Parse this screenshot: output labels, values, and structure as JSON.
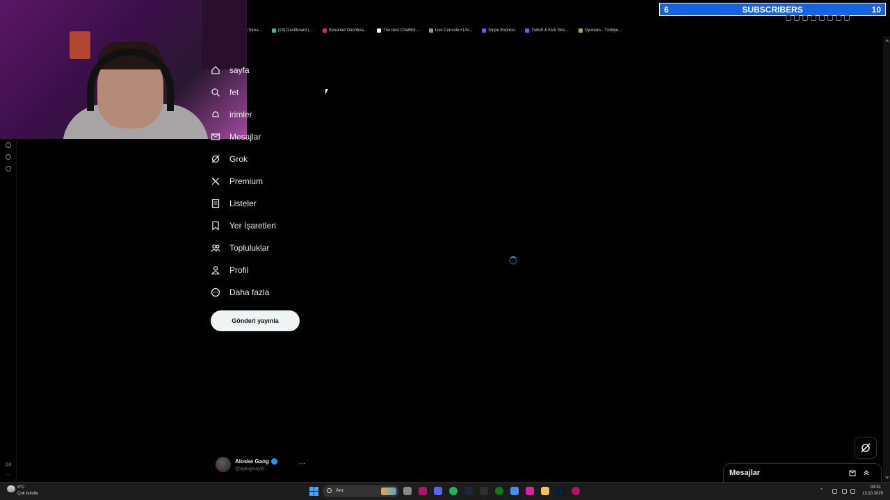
{
  "browser": {
    "bookmarks": [
      {
        "label": "ng Strea...",
        "color": "#9146ff"
      },
      {
        "label": "(23) Dashboard |...",
        "color": "#3fb9a6"
      },
      {
        "label": "Streamer Dashboa...",
        "color": "#e0245e"
      },
      {
        "label": "The best ChatBot...",
        "color": "#ffffff"
      },
      {
        "label": "Live Console • LIV...",
        "color": "#999999"
      },
      {
        "label": "Stripe Express",
        "color": "#635bff"
      },
      {
        "label": "Twitch & Kick Stre...",
        "color": "#9146ff"
      },
      {
        "label": "Oyuneks - Türkiye...",
        "color": "#7fbf3f"
      }
    ]
  },
  "overlay": {
    "sub_left": "6",
    "sub_label": "SUBSCRIBERS",
    "sub_right": "10",
    "bar_color": "#1463e6"
  },
  "nav": {
    "items": [
      {
        "label": "sayfa",
        "icon": "home-icon"
      },
      {
        "label": "fet",
        "icon": "search-icon"
      },
      {
        "label": "irimler",
        "icon": "bell-icon"
      },
      {
        "label": "Mesajlar",
        "icon": "mail-icon"
      },
      {
        "label": "Grok",
        "icon": "grok-icon"
      },
      {
        "label": "Premium",
        "icon": "x-logo-icon"
      },
      {
        "label": "Listeler",
        "icon": "list-icon"
      },
      {
        "label": "Yer İşaretleri",
        "icon": "bookmark-icon"
      },
      {
        "label": "Topluluklar",
        "icon": "communities-icon"
      },
      {
        "label": "Profil",
        "icon": "profile-icon"
      },
      {
        "label": "Daha fazla",
        "icon": "more-circle-icon"
      }
    ],
    "post_button": "Gönderi yayınla"
  },
  "profile": {
    "name": "Aloske Gang",
    "handle": "@aylogluayl0",
    "more": "···"
  },
  "messages_drawer": {
    "title": "Mesajlar"
  },
  "left_rail": {
    "bottom_label": "GX",
    "dots": "···"
  },
  "taskbar": {
    "weather_temp": "9°C",
    "weather_desc": "Çok bulutlu",
    "search_label": "Ara",
    "time": "03:31",
    "date": "13.10.2025"
  },
  "colors": {
    "accent": "#1d9bf0",
    "background": "#000000",
    "text": "#e7e9ea"
  }
}
